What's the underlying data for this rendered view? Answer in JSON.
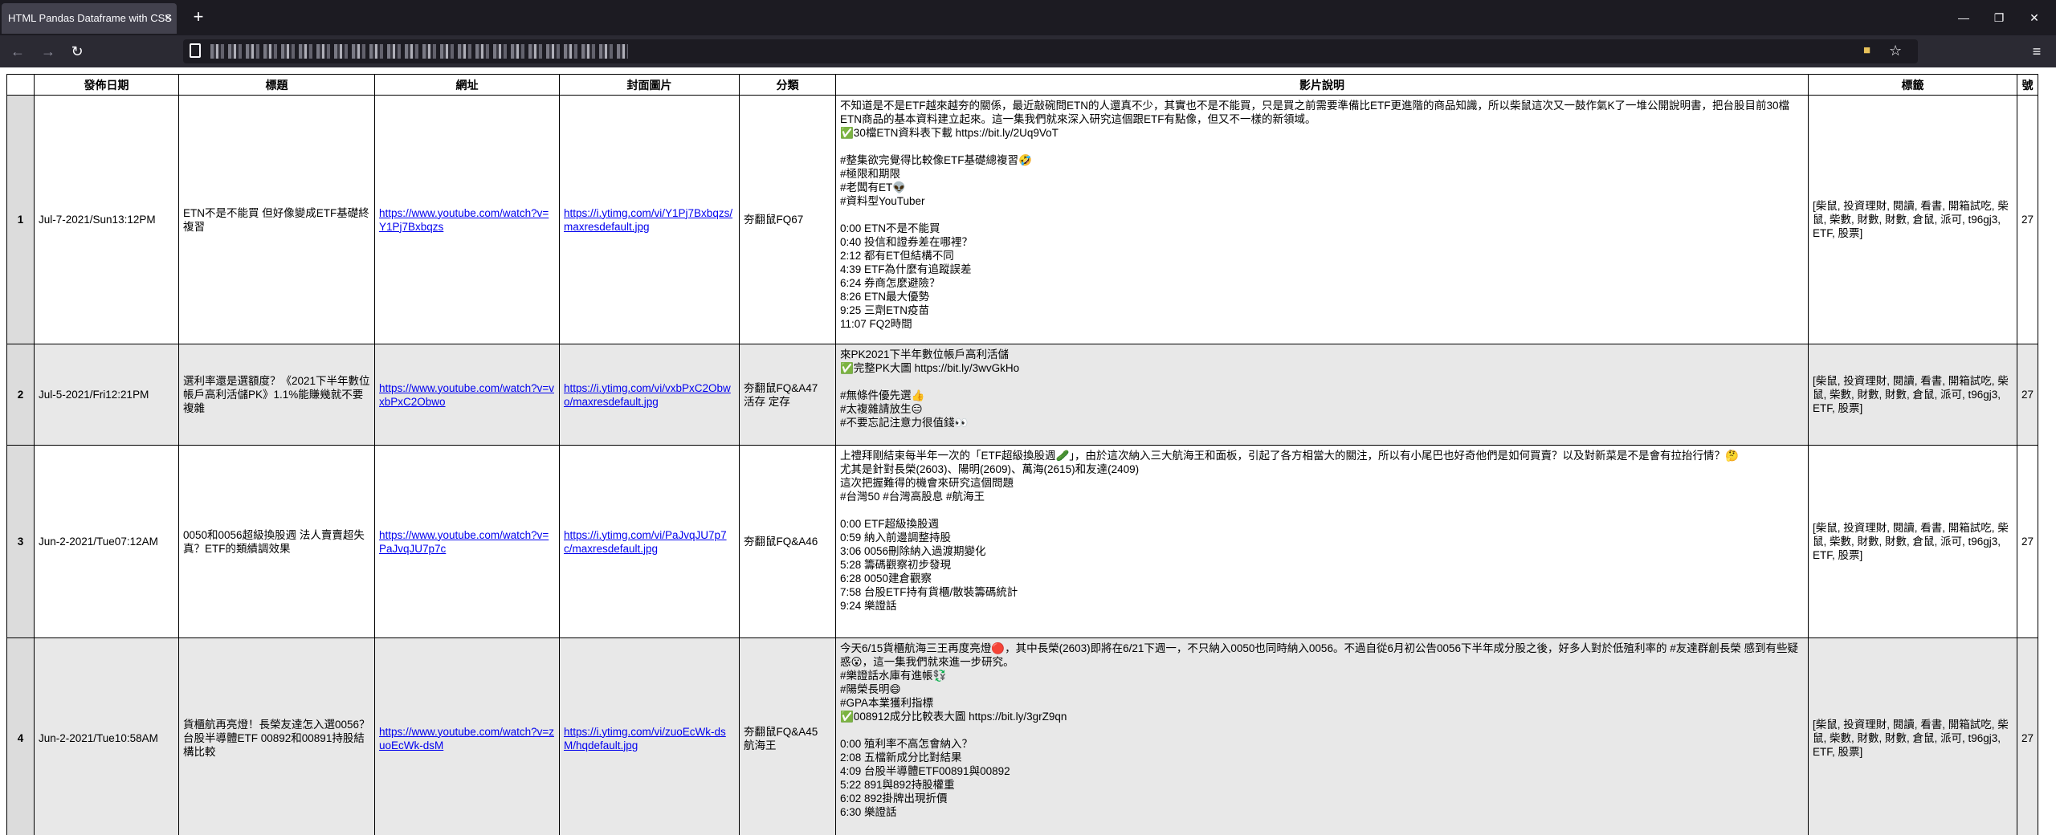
{
  "browser": {
    "tab_title": "HTML Pandas Dataframe with CSS",
    "tab_close": "×",
    "new_tab": "+",
    "window": {
      "minimize": "—",
      "restore": "❐",
      "close": "✕"
    },
    "nav": {
      "back": "←",
      "forward": "→",
      "reload": "↻",
      "menu": "≡"
    },
    "url_obscured": "▘▗▝▖ ▗▘▝ ▖▗▘▝▗▖▘ ▝▖▗ ▘▗▝▖▘▗ ▝▘▗▖"
  },
  "table": {
    "headers": [
      "",
      "發佈日期",
      "標題",
      "網址",
      "封面圖片",
      "分類",
      "影片說明",
      "標籤",
      "號"
    ],
    "rows": [
      {
        "index": "1",
        "date": "Jul-7-2021/Sun13:12PM",
        "title": "ETN不是不能買 但好像變成ETF基礎終複習",
        "url": "https://www.youtube.com/watch?v=Y1Pj7Bxbqzs",
        "thumb": "https://i.ytimg.com/vi/Y1Pj7Bxbqzs/maxresdefault.jpg",
        "category": "夯翻鼠FQ67",
        "description": "不知道是不是ETF越來越夯的關係，最近敲碗問ETN的人還真不少，其實也不是不能買，只是買之前需要準備比ETF更進階的商品知識，所以柴鼠這次又一鼓作氣K了一堆公開說明書，把台股目前30檔ETN商品的基本資料建立起來。這一集我們就來深入研究這個跟ETF有點像，但又不一樣的新領域。\n✅30檔ETN資料表下載 https://bit.ly/2Uq9VoT\n\n#整集欲完覺得比較像ETF基礎總複習🤣\n#極限和期限\n#老闆有ET👽\n#資料型YouTuber\n\n0:00 ETN不是不能買\n0:40 投信和證券差在哪裡？\n2:12 都有ET但結構不同\n4:39 ETF為什麼有追蹤誤差\n6:24 券商怎麼避險？\n8:26 ETN最大優勢\n9:25 三劑ETN疫苗\n11:07 FQ2時間",
        "tags": "[柴鼠, 投資理財, 閱讀, 看書, 開箱試吃, 柴鼠, 柴數, 財數, 財數, 倉鼠, 派可, t96gj3, ETF, 股票]",
        "num": "27"
      },
      {
        "index": "2",
        "date": "Jul-5-2021/Fri12:21PM",
        "title": "選利率還是選額度？《2021下半年數位帳戶高利活儲PK》1.1%能賺幾就不要複雜",
        "url": "https://www.youtube.com/watch?v=vxbPxC2Obwo",
        "thumb": "https://i.ytimg.com/vi/vxbPxC2Obwo/maxresdefault.jpg",
        "category": "夯翻鼠FQ&A47 活存 定存",
        "description": "來PK2021下半年數位帳戶高利活儲\n✅完整PK大圖 https://bit.ly/3wvGkHo\n\n#無條件優先選👍\n#太複雜請放生😑\n#不要忘記注意力很值錢👀",
        "tags": "[柴鼠, 投資理財, 閱讀, 看書, 開箱試吃, 柴鼠, 柴數, 財數, 財數, 倉鼠, 派可, t96gj3, ETF, 股票]",
        "num": "27"
      },
      {
        "index": "3",
        "date": "Jun-2-2021/Tue07:12AM",
        "title": "0050和0056超級換股週 法人賣賣超失真？ETF的類績調效果",
        "url": "https://www.youtube.com/watch?v=PaJvqJU7p7c",
        "thumb": "https://i.ytimg.com/vi/PaJvqJU7p7c/maxresdefault.jpg",
        "category": "夯翻鼠FQ&A46",
        "description": "上禮拜剛結束每半年一次的「ETF超級換股週🥒」，由於這次納入三大航海王和面板，引起了各方相當大的關注，所以有小尾巴也好奇他們是如何買賣？以及對新菜是不是會有拉抬行情？🤔\n尤其是針對長榮(2603)、陽明(2609)、萬海(2615)和友達(2409)\n這次把握難得的機會來研究這個問題\n#台灣50 #台灣高股息 #航海王\n\n0:00 ETF超級換股週\n0:59 納入前邊調整持股\n3:06 0056刪除納入過渡期變化\n5:28 籌碼觀察初步發現\n6:28 0050建倉觀察\n7:58 台股ETF持有貨櫃/散裝籌碼統計\n9:24 樂證話",
        "tags": "[柴鼠, 投資理財, 閱讀, 看書, 開箱試吃, 柴鼠, 柴數, 財數, 財數, 倉鼠, 派可, t96gj3, ETF, 股票]",
        "num": "27"
      },
      {
        "index": "4",
        "date": "Jun-2-2021/Tue10:58AM",
        "title": "貨櫃航再亮燈！長榮友達怎入選0056？台股半導體ETF 00892和00891持股結構比較",
        "url": "https://www.youtube.com/watch?v=zuoEcWk-dsM",
        "thumb": "https://i.ytimg.com/vi/zuoEcWk-dsM/hqdefault.jpg",
        "category": "夯翻鼠FQ&A45 航海王",
        "description": "今天6/15貨櫃航海三王再度亮燈🔴，其中長榮(2603)即將在6/21下週一，不只納入0050也同時納入0056。不過自從6月初公告0056下半年成分股之後，好多人對於低殖利率的 #友達群創長榮 感到有些疑惑😮，這一集我們就來進一步研究。\n#樂證話水庫有進帳💱\n#陽榮長明😄\n#GPA本業獲利指標\n✅008912成分比較表大圖 https://bit.ly/3grZ9qn\n\n0:00 殖利率不高怎會納入？\n2:08 五檔新成分比對結果\n4:09 台股半導體ETF00891與00892\n5:22 891與892持股權重\n6:02 892掛牌出現折價\n6:30 樂證話",
        "tags": "[柴鼠, 投資理財, 閱讀, 看書, 開箱試吃, 柴鼠, 柴數, 財數, 財數, 倉鼠, 派可, t96gj3, ETF, 股票]",
        "num": "27"
      }
    ]
  }
}
